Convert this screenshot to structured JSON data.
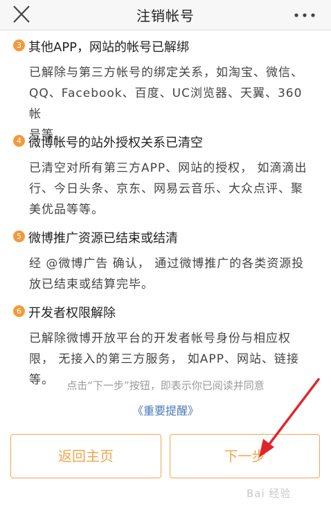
{
  "header": {
    "title": "注销帐号",
    "close_icon": "close-icon",
    "more_icon": "more-icon"
  },
  "sections": [
    {
      "number": "3",
      "title": "其他APP，网站的帐号已解绑",
      "lines": [
        "已解除与第三方帐号的绑定关系，如淘宝、微信、",
        "QQ、Facebook、百度、UC浏览器、天翼、360帐",
        "号等。"
      ]
    },
    {
      "number": "4",
      "title": "微博帐号的站外授权关系已清空",
      "lines": [
        "已清空对所有第三方APP、网站的授权， 如滴滴出",
        "行、今日头条、京东、网易云音乐、大众点评、聚",
        "美优品等等。"
      ]
    },
    {
      "number": "5",
      "title": "微博推广资源已结束或结清",
      "lines": [
        "经 @微博广告 确认， 通过微博推广的各类资源投",
        "放已结束或结算完毕。"
      ]
    },
    {
      "number": "6",
      "title": "开发者权限解除",
      "lines": [
        "已解除微博开放平台的开发者帐号身份与相应权",
        "限， 无接入的第三方服务， 如APP、网站、链接",
        "等。"
      ]
    }
  ],
  "notice": {
    "text": "点击“下一步”按钮，即表示你已阅读并同意",
    "link": "《重要提醒》"
  },
  "buttons": {
    "home": "返回主页",
    "next": "下一步"
  },
  "watermark": "Bai 经验",
  "colors": {
    "accent": "#f0a648",
    "badge": "#f29a3b",
    "link": "#4a78b5",
    "annotation_arrow": "#e0242b"
  }
}
